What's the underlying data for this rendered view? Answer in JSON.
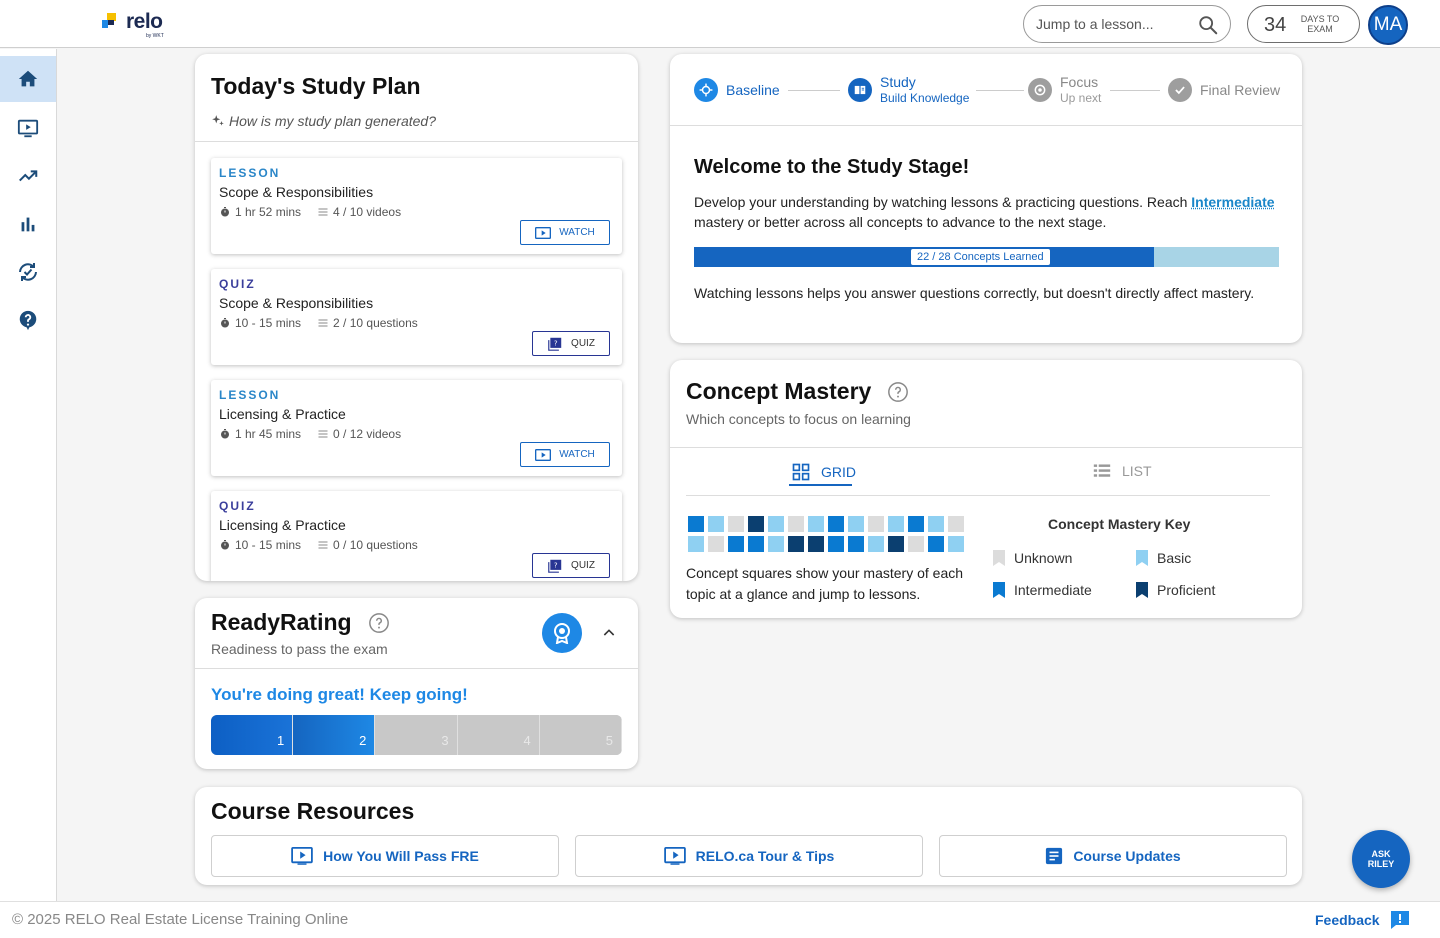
{
  "brand": {
    "name": "relo",
    "sub": "by WKT"
  },
  "header": {
    "search_placeholder": "Jump to a lesson...",
    "days_to_exam": "34",
    "days_label": "DAYS TO EXAM",
    "avatar_initials": "MA"
  },
  "sidebar": {
    "items": [
      "home",
      "lessons",
      "progress",
      "stats",
      "review",
      "help"
    ]
  },
  "study_plan": {
    "title": "Today's Study Plan",
    "subtitle": "How is my study plan generated?",
    "items": [
      {
        "type": "LESSON",
        "title": "Scope & Responsibilities",
        "time": "1 hr 52 mins",
        "count": "4 / 10 videos",
        "button": "WATCH"
      },
      {
        "type": "QUIZ",
        "title": "Scope & Responsibilities",
        "time": "10 - 15 mins",
        "count": "2 / 10 questions",
        "button": "QUIZ"
      },
      {
        "type": "LESSON",
        "title": "Licensing & Practice",
        "time": "1 hr 45 mins",
        "count": "0 / 12 videos",
        "button": "WATCH"
      },
      {
        "type": "QUIZ",
        "title": "Licensing & Practice",
        "time": "10 - 15 mins",
        "count": "0 / 10 questions",
        "button": "QUIZ"
      }
    ]
  },
  "stages": {
    "steps": [
      {
        "label": "Baseline",
        "sub": "",
        "state": "done"
      },
      {
        "label": "Study",
        "sub": "Build Knowledge",
        "state": "current"
      },
      {
        "label": "Focus",
        "sub": "Up next",
        "state": "upcoming"
      },
      {
        "label": "Final Review",
        "sub": "",
        "state": "upcoming"
      }
    ],
    "welcome_title": "Welcome to the Study Stage!",
    "desc_prefix": "Develop your understanding by watching lessons & practicing questions. Reach",
    "desc_link": "Intermediate",
    "desc_suffix": "mastery or better across all concepts to advance to the next stage.",
    "progress_label": "22 / 28 Concepts Learned",
    "progress_fraction": 0.7857,
    "note": "Watching lessons helps you answer questions correctly, but doesn't directly affect mastery."
  },
  "concept_mastery": {
    "title": "Concept Mastery",
    "subtitle": "Which concepts to focus on learning",
    "tab_grid": "GRID",
    "tab_list": "LIST",
    "squares": [
      "intermediate",
      "basic",
      "unknown",
      "proficient",
      "basic",
      "unknown",
      "basic",
      "intermediate",
      "basic",
      "unknown",
      "basic",
      "intermediate",
      "basic",
      "unknown",
      "basic",
      "unknown",
      "intermediate",
      "intermediate",
      "basic",
      "proficient",
      "proficient",
      "intermediate",
      "intermediate",
      "basic",
      "proficient",
      "unknown",
      "intermediate",
      "basic"
    ],
    "colors": {
      "unknown": "#dcdcdc",
      "basic": "#8fd0f2",
      "intermediate": "#0a7ad1",
      "proficient": "#0b3f70"
    },
    "caption": "Concept squares show your mastery of each topic at a glance and jump to lessons.",
    "key_title": "Concept Mastery Key",
    "key": [
      {
        "name": "Unknown",
        "level": "unknown"
      },
      {
        "name": "Basic",
        "level": "basic"
      },
      {
        "name": "Intermediate",
        "level": "intermediate"
      },
      {
        "name": "Proficient",
        "level": "proficient"
      }
    ]
  },
  "ready_rating": {
    "title": "ReadyRating",
    "subtitle": "Readiness to pass the exam",
    "message": "You're doing great! Keep going!",
    "levels": [
      "1",
      "2",
      "3",
      "4",
      "5"
    ],
    "current_level": 2
  },
  "resources": {
    "title": "Course Resources",
    "buttons": [
      {
        "label": "How You Will Pass FRE",
        "icon": "video-icon"
      },
      {
        "label": "RELO.ca Tour & Tips",
        "icon": "video-icon"
      },
      {
        "label": "Course Updates",
        "icon": "document-icon"
      }
    ]
  },
  "footer": {
    "copyright": "© 2025 RELO Real Estate License Training Online",
    "feedback": "Feedback"
  },
  "ask_riley": {
    "line1": "ASK",
    "line2": "RILEY"
  }
}
